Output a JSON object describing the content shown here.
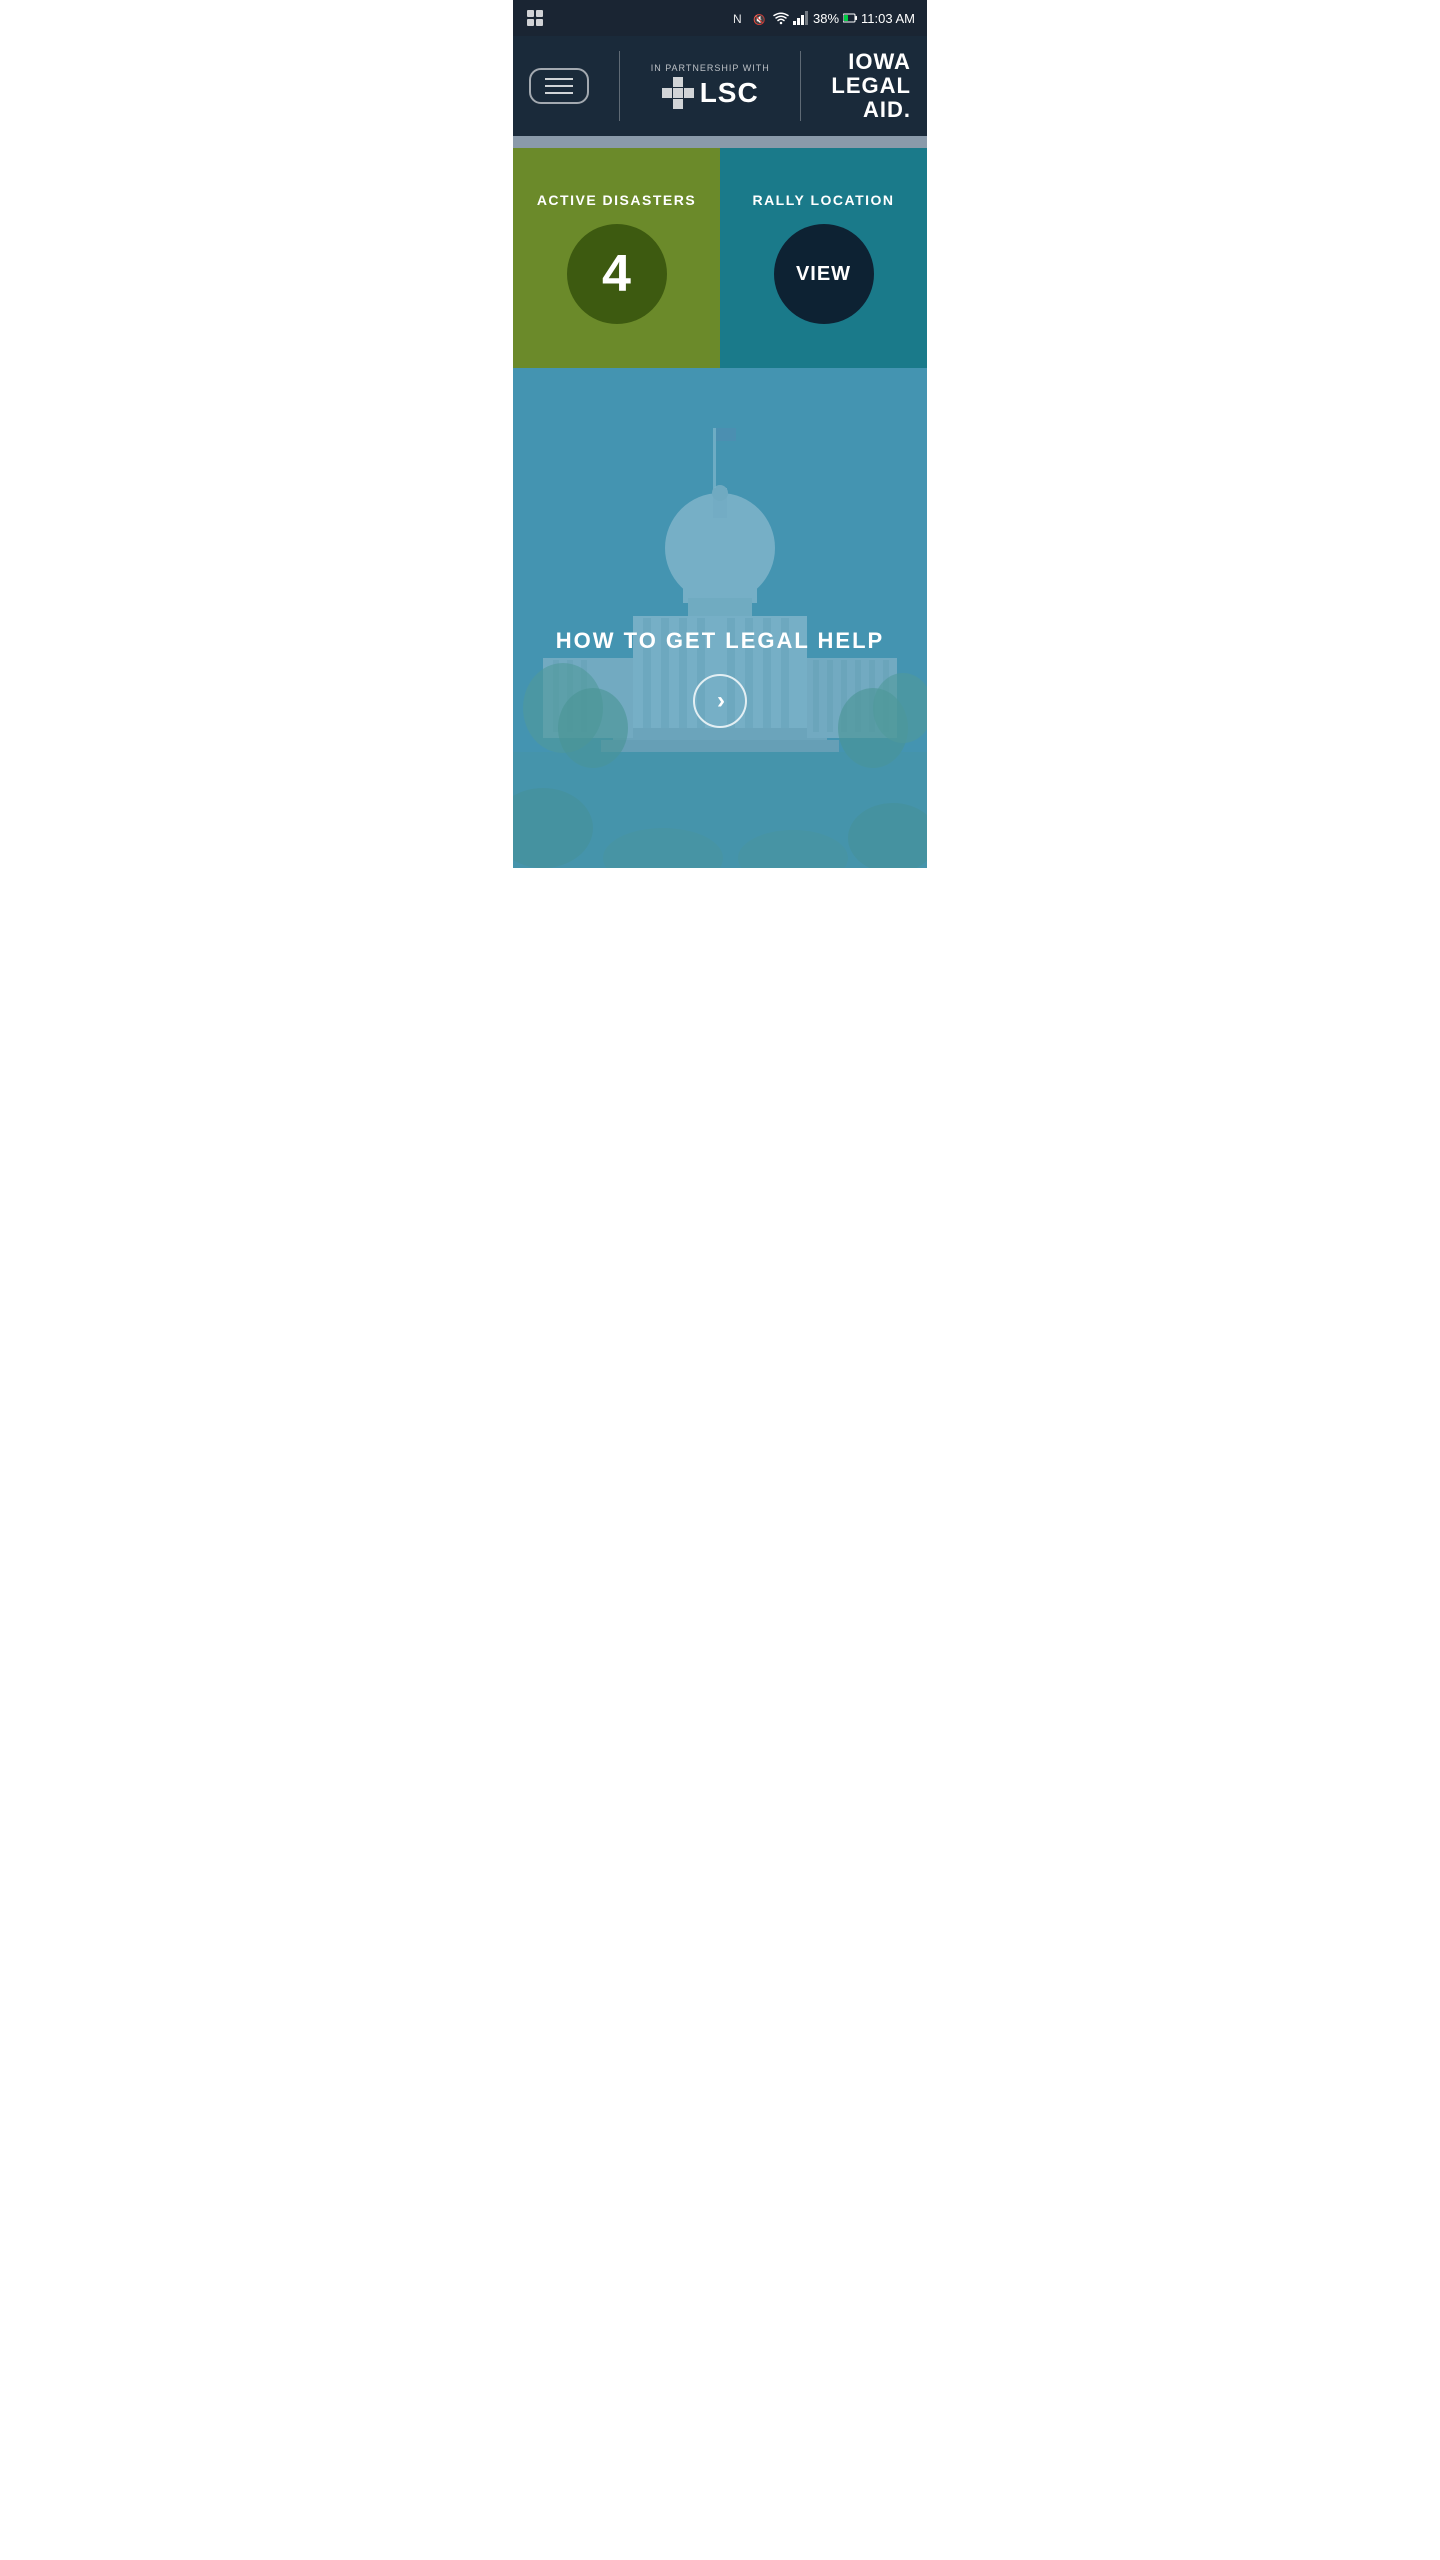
{
  "statusBar": {
    "battery": "38%",
    "time": "11:03 AM",
    "leftIcon": "app-icon"
  },
  "header": {
    "menuButton": "menu",
    "partnershipText": "IN PARTNERSHIP WITH",
    "lscLabel": "LSC",
    "logoTitle": "IOWA LEGAL AID",
    "iowa": "IOWA",
    "legal": "LEGAL",
    "aid": "AID."
  },
  "disasters": {
    "activeDisastersLabel": "ACTIVE DISASTERS",
    "activeDisastersCount": "4",
    "rallyLocationLabel": "RALLY LOCATION",
    "rallyViewLabel": "VIEW"
  },
  "legalHelp": {
    "title": "HOW TO GET LEGAL HELP",
    "arrowLabel": "›"
  }
}
